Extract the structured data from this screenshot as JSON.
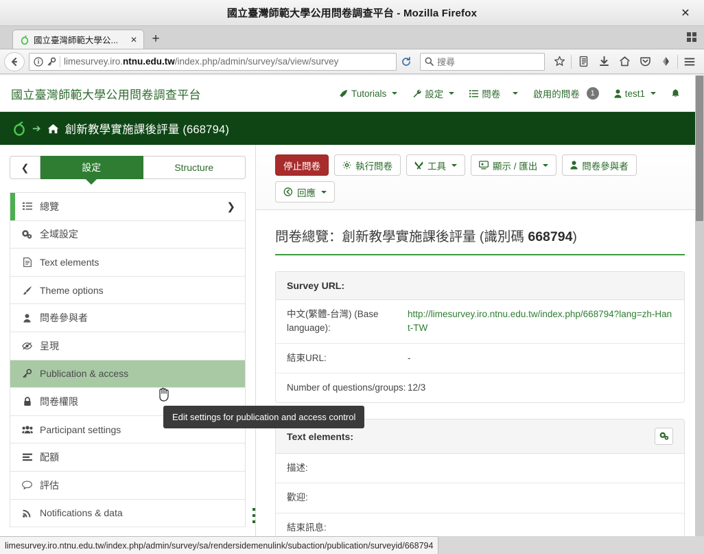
{
  "browser": {
    "window_title": "國立臺灣師範大學公用問卷調查平台 - Mozilla Firefox",
    "close_label": "✕",
    "tab": {
      "label": "國立臺灣師範大學公...",
      "close_label": "✕",
      "favicon_name": "limesurvey-favicon"
    },
    "new_tab_label": "+",
    "url_prefix": "limesurvey.iro.",
    "url_domain": "ntnu.edu.tw",
    "url_suffix": "/index.php/admin/survey/sa/view/survey",
    "search_placeholder": "搜尋",
    "nav_icons": [
      "star-icon",
      "library-icon",
      "download-icon",
      "home-icon",
      "pocket-icon",
      "sync-icon",
      "menu-icon"
    ]
  },
  "statusbar": {
    "url": "limesurvey.iro.ntnu.edu.tw/index.php/admin/survey/sa/rendersidemenulink/subaction/publication/surveyid/668794"
  },
  "app": {
    "brand": "國立臺灣師範大學公用問卷調查平台",
    "menu": [
      {
        "label": "Tutorials",
        "icon": "rocket-icon",
        "caret": true,
        "badge": null
      },
      {
        "label": "設定",
        "icon": "wrench-icon",
        "caret": true,
        "badge": null
      },
      {
        "label": "問卷",
        "icon": "list-icon",
        "caret": true,
        "badge": null
      },
      {
        "label": "啟用的問卷",
        "icon": null,
        "caret": false,
        "badge": "1"
      },
      {
        "label": "test1",
        "icon": "user-icon",
        "caret": true,
        "badge": null
      },
      {
        "label": "",
        "icon": "bell-icon",
        "caret": false,
        "badge": null
      }
    ]
  },
  "survey_bar": {
    "title": "創新教學實施課後評量 (668794)",
    "home_icon": "home-icon",
    "arrow_icon": "arrow-right-icon",
    "logo_icon": "limesurvey-logo-icon"
  },
  "sidebar": {
    "back_label": "❮",
    "tabs": [
      {
        "label": "設定",
        "active": true
      },
      {
        "label": "Structure",
        "active": false
      }
    ],
    "items": [
      {
        "label": "總覽",
        "icon": "list-icon",
        "state": "selected",
        "chevron": "❯"
      },
      {
        "label": "全域設定",
        "icon": "gears-icon",
        "state": "normal",
        "chevron": ""
      },
      {
        "label": "Text elements",
        "icon": "file-icon",
        "state": "normal",
        "chevron": ""
      },
      {
        "label": "Theme options",
        "icon": "brush-icon",
        "state": "normal",
        "chevron": ""
      },
      {
        "label": "問卷參與者",
        "icon": "user-icon",
        "state": "normal",
        "chevron": ""
      },
      {
        "label": "呈現",
        "icon": "eye-slash-icon",
        "state": "normal",
        "chevron": ""
      },
      {
        "label": "Publication & access",
        "icon": "key-icon",
        "state": "hover",
        "chevron": ""
      },
      {
        "label": "問卷權限",
        "icon": "lock-icon",
        "state": "normal",
        "chevron": ""
      },
      {
        "label": "Participant settings",
        "icon": "users-icon",
        "state": "normal",
        "chevron": ""
      },
      {
        "label": "配額",
        "icon": "bars-icon",
        "state": "normal",
        "chevron": ""
      },
      {
        "label": "評估",
        "icon": "comment-icon",
        "state": "normal",
        "chevron": ""
      },
      {
        "label": "Notifications & data",
        "icon": "rss-icon",
        "state": "normal",
        "chevron": ""
      }
    ]
  },
  "tooltip": {
    "text": "Edit settings for publication and access control"
  },
  "toolbar": {
    "buttons": [
      {
        "label": "停止問卷",
        "icon": null,
        "style": "danger",
        "caret": false
      },
      {
        "label": "執行問卷",
        "icon": "gear-icon",
        "style": "default",
        "caret": false
      },
      {
        "label": "工具",
        "icon": "tools-icon",
        "style": "default",
        "caret": true
      },
      {
        "label": "顯示 / 匯出",
        "icon": "display-icon",
        "style": "default",
        "caret": true
      },
      {
        "label": "問卷參與者",
        "icon": "user-icon",
        "style": "default",
        "caret": false
      },
      {
        "label": "回應",
        "icon": "reply-icon",
        "style": "default",
        "caret": true
      }
    ]
  },
  "main": {
    "page_title_prefix": "問卷總覽：創新教學實施課後評量 (識別碼 ",
    "page_title_id": "668794",
    "page_title_suffix": ")",
    "cards": [
      {
        "title": "Survey URL:",
        "gear": false,
        "rows": [
          {
            "key": "中文(繁體-台灣) (Base language):",
            "value": "http://limesurvey.iro.ntnu.edu.tw/index.php/668794?lang=zh-Hant-TW",
            "is_link": true
          },
          {
            "key": "結束URL:",
            "value": "-",
            "is_link": false
          },
          {
            "key": "Number of questions/groups:",
            "value": "12/3",
            "is_link": false
          }
        ]
      },
      {
        "title": "Text elements:",
        "gear": true,
        "gear_icon": "gears-icon",
        "rows": [
          {
            "key": "描述:",
            "value": "",
            "is_link": false
          },
          {
            "key": "歡迎:",
            "value": "",
            "is_link": false
          },
          {
            "key": "結束訊息:",
            "value": "",
            "is_link": false
          }
        ]
      }
    ]
  },
  "colors": {
    "brand_green": "#2e6b2e",
    "dark_green": "#0f4515",
    "tab_green": "#2e7d32",
    "accent_green": "#4caf50",
    "danger_red": "#a82c2c",
    "hover_green": "#a8c9a4",
    "link_green": "#2e7d32"
  }
}
